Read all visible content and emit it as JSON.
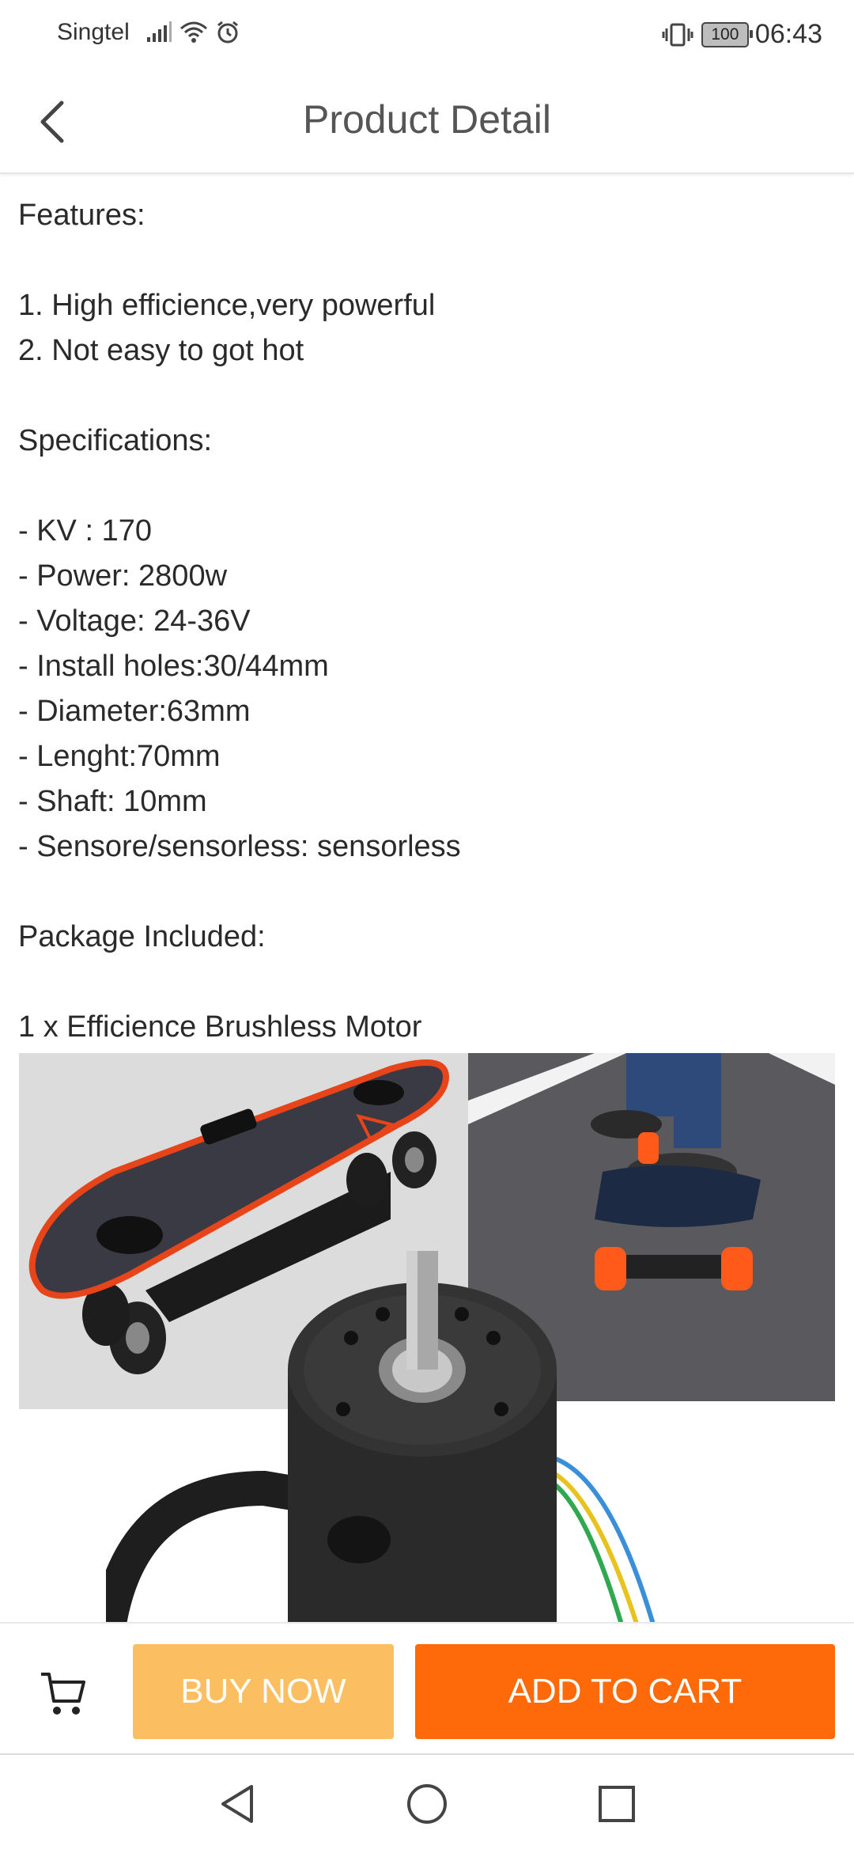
{
  "status_bar": {
    "carrier": "Singtel",
    "battery": "100",
    "time": "06:43",
    "icons": [
      "signal-icon",
      "wifi-icon",
      "alarm-icon",
      "vibrate-icon",
      "battery-icon"
    ]
  },
  "header": {
    "title": "Product Detail",
    "back_icon": "chevron-left-icon"
  },
  "description": {
    "features_heading": "Features:",
    "features": [
      "1. High efficience,very powerful",
      "2. Not easy to got hot"
    ],
    "specs_heading": "Specifications:",
    "specs": [
      "- KV : 170",
      "- Power: 2800w",
      "- Voltage: 24-36V",
      "- Install holes:30/44mm",
      "- Diameter:63mm",
      "- Lenght:70mm",
      "- Shaft: 10mm",
      "- Sensore/sensorless: sensorless"
    ],
    "package_heading": "Package Included:",
    "package_item": "1 x Efficience Brushless Motor"
  },
  "gallery": {
    "images": [
      "electric-skateboard-photo",
      "riding-longboard-photo",
      "brushless-motor-photo"
    ]
  },
  "actions": {
    "cart_icon": "cart-icon",
    "buy_now": "BUY NOW",
    "add_to_cart": "ADD TO CART",
    "colors": {
      "buy_now_bg": "#fbbf62",
      "add_to_cart_bg": "#fe6a09"
    }
  },
  "nav": {
    "icons": [
      "back-triangle-icon",
      "home-circle-icon",
      "recents-square-icon"
    ]
  }
}
